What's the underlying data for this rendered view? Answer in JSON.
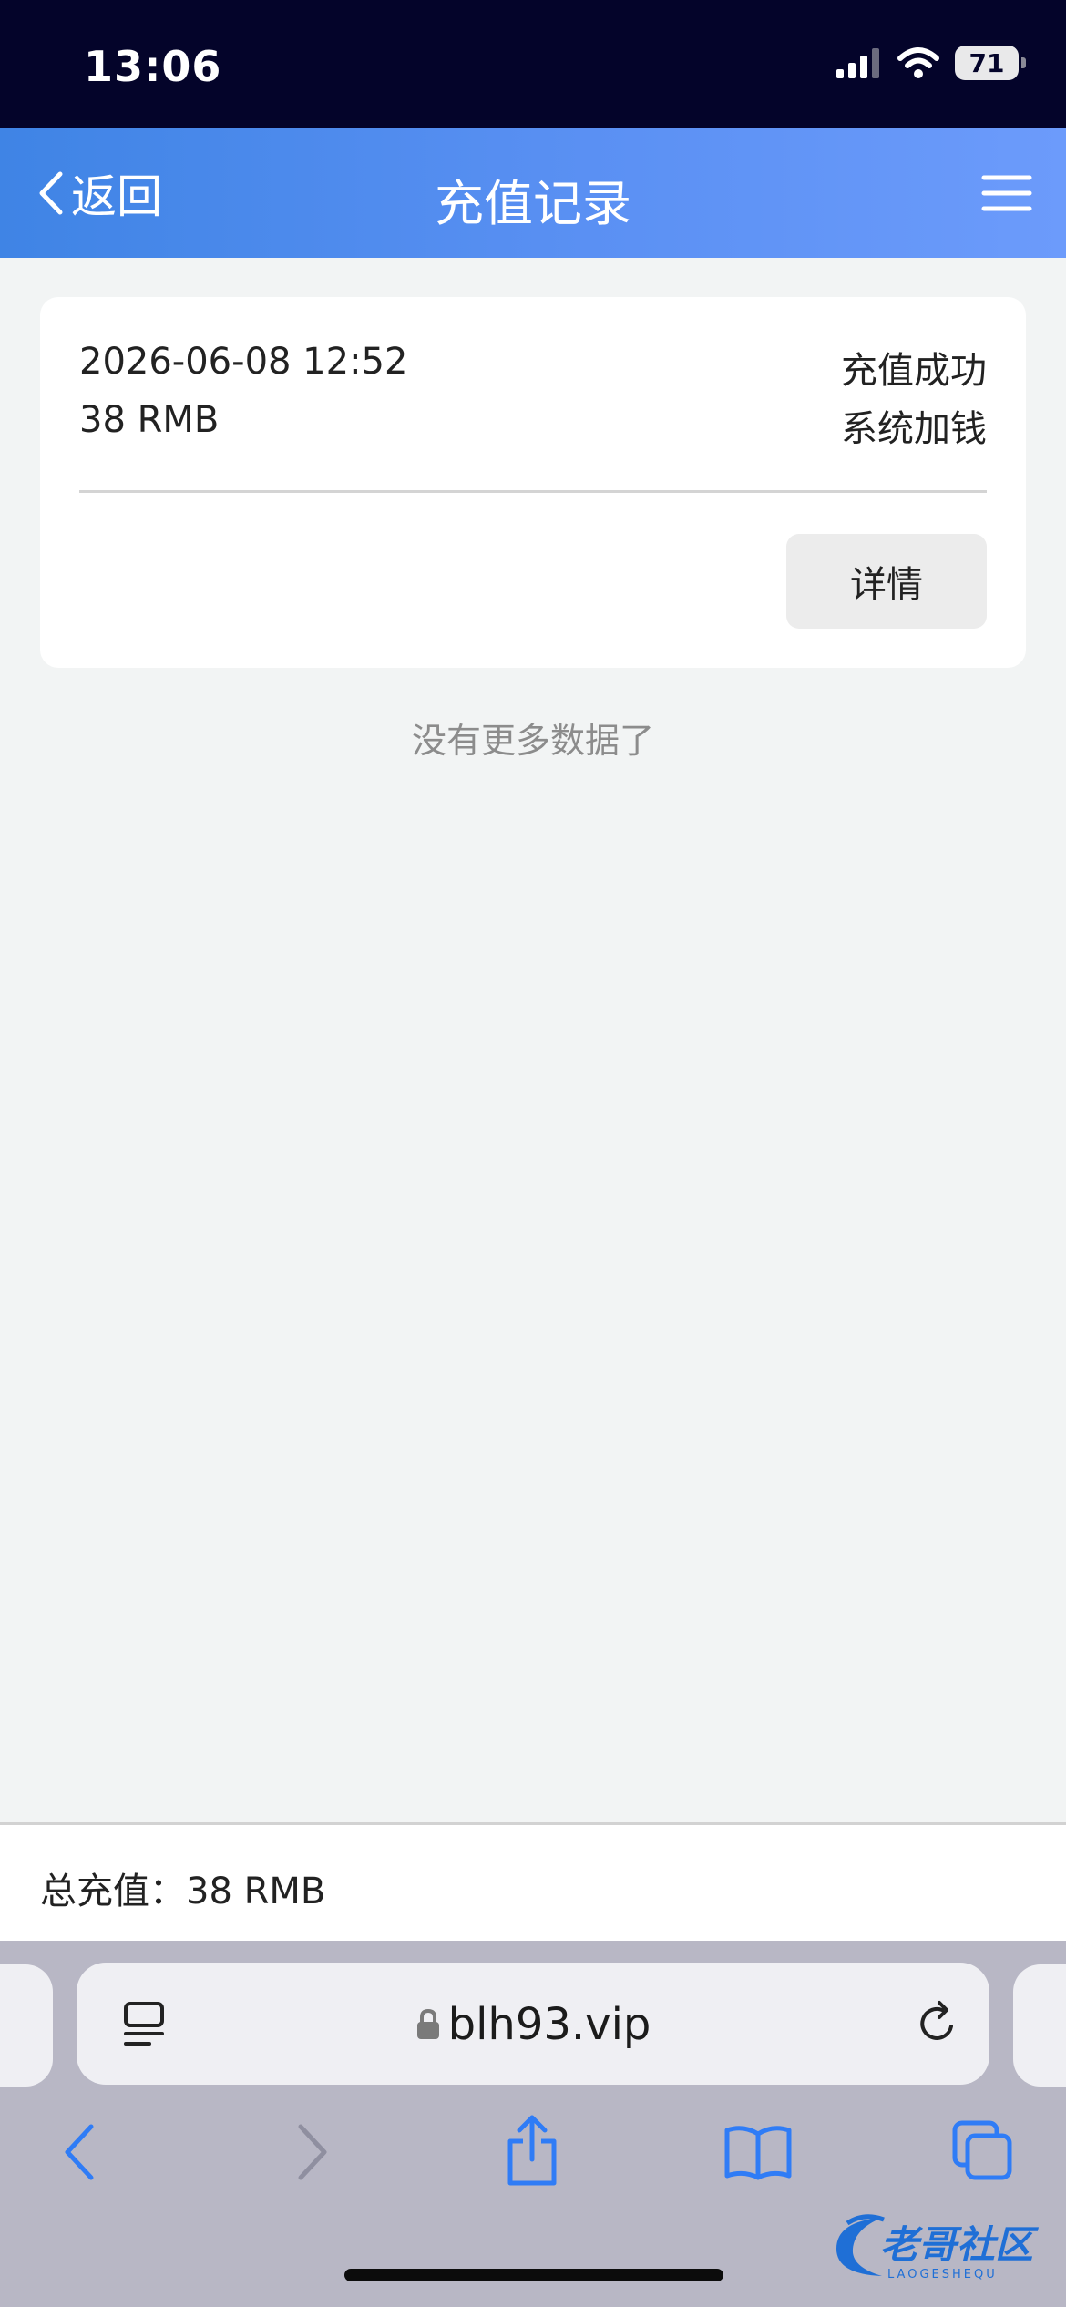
{
  "status_bar": {
    "time": "13:06",
    "battery": "71",
    "icons": [
      "signal-icon",
      "wifi-icon",
      "battery-icon"
    ]
  },
  "nav": {
    "back_label": "返回",
    "title": "充值记录",
    "icons": [
      "chevron-left-icon",
      "menu-icon"
    ]
  },
  "records": [
    {
      "datetime": "2026-06-08 12:52",
      "amount": "38 RMB",
      "status": "充值成功",
      "type": "系统加钱",
      "detail_label": "详情"
    }
  ],
  "list_end_text": "没有更多数据了",
  "summary": {
    "total_text": "总充值：38 RMB"
  },
  "browser": {
    "url": "blh93.vip",
    "icons": [
      "tabs-overview-icon",
      "lock-icon",
      "reload-icon",
      "back-icon",
      "forward-icon",
      "share-icon",
      "bookmarks-icon",
      "tabs-icon"
    ]
  },
  "watermark": {
    "text": "老哥社区",
    "subtext": "LAOGESHEQU"
  },
  "colors": {
    "status_bar_bg": "#04042a",
    "nav_gradient_start": "#3f84e5",
    "nav_gradient_end": "#6c9bfb",
    "page_bg": "#f2f4f4",
    "browser_bg": "#b8b7c5",
    "browser_icon": "#2f7cf6"
  }
}
